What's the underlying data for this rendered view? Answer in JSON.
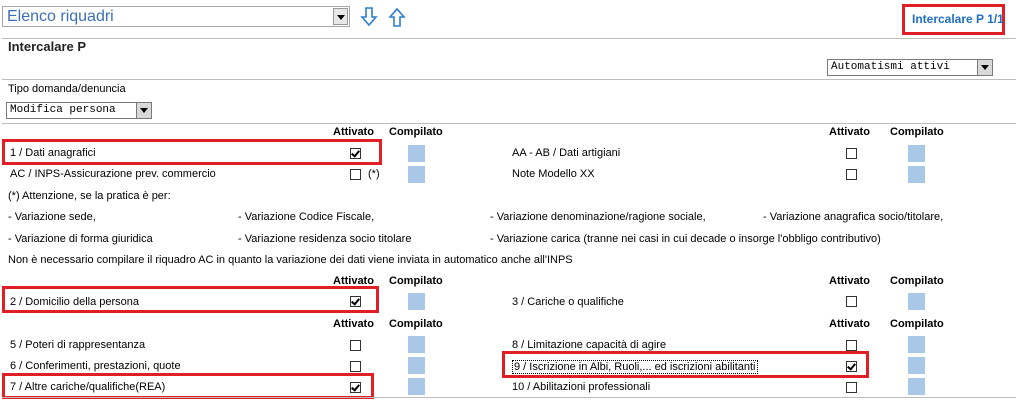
{
  "toolbar": {
    "section_select": "Elenco riquadri",
    "down_icon": "arrow-down-icon",
    "up_icon": "arrow-up-icon",
    "intercalare_link": "Intercalare P 1/1"
  },
  "page": {
    "title": "Intercalare P",
    "automatismi_select": "Automatismi attivi",
    "tipo_label": "Tipo domanda/denuncia",
    "tipo_select": "Modifica persona"
  },
  "headers": {
    "attivato": "Attivato",
    "compilato": "Compilato"
  },
  "section1": {
    "left": [
      {
        "label": "1 / Dati anagrafici",
        "checked": true,
        "suffix": ""
      },
      {
        "label": "AC / INPS-Assicurazione prev. commercio",
        "checked": false,
        "suffix": "(*)"
      }
    ],
    "right": [
      {
        "label": "AA - AB / Dati artigiani",
        "checked": false
      },
      {
        "label": "Note Modello XX",
        "checked": false
      }
    ]
  },
  "notes": {
    "attention": "(*) Attenzione, se la pratica è per:",
    "row1": [
      "- Variazione sede,",
      "- Variazione Codice Fiscale,",
      "- Variazione denominazione/ragione sociale,",
      "- Variazione anagrafica socio/titolare,"
    ],
    "row2": [
      "- Variazione di forma giuridica",
      "- Variazione residenza socio titolare",
      "- Variazione carica (tranne nei casi in cui decade o insorge l'obbligo contributivo)"
    ],
    "final": "Non è necessario compilare il riquadro AC in quanto la variazione dei dati viene inviata in automatico anche all'INPS"
  },
  "section2": {
    "left": {
      "label": "2 / Domicilio della persona",
      "checked": true
    },
    "right": {
      "label": "3 / Cariche o qualifiche",
      "checked": false
    }
  },
  "section3": {
    "left": [
      {
        "label": "5 / Poteri di rappresentanza",
        "checked": false
      },
      {
        "label": "6 / Conferimenti, prestazioni, quote",
        "checked": false
      },
      {
        "label": "7 / Altre cariche/qualifiche(REA)",
        "checked": true
      }
    ],
    "right": [
      {
        "label": "8 / Limitazione capacità di agire",
        "checked": false
      },
      {
        "label": "9 / Iscrizione in Albi, Ruoli,... ed iscrizioni abilitanti",
        "checked": true
      },
      {
        "label": "10 / Abilitazioni professionali",
        "checked": false
      }
    ]
  },
  "colors": {
    "accent": "#1f6fc5",
    "highlight": "#e01e26",
    "compilato_box": "#a9c8e8"
  }
}
